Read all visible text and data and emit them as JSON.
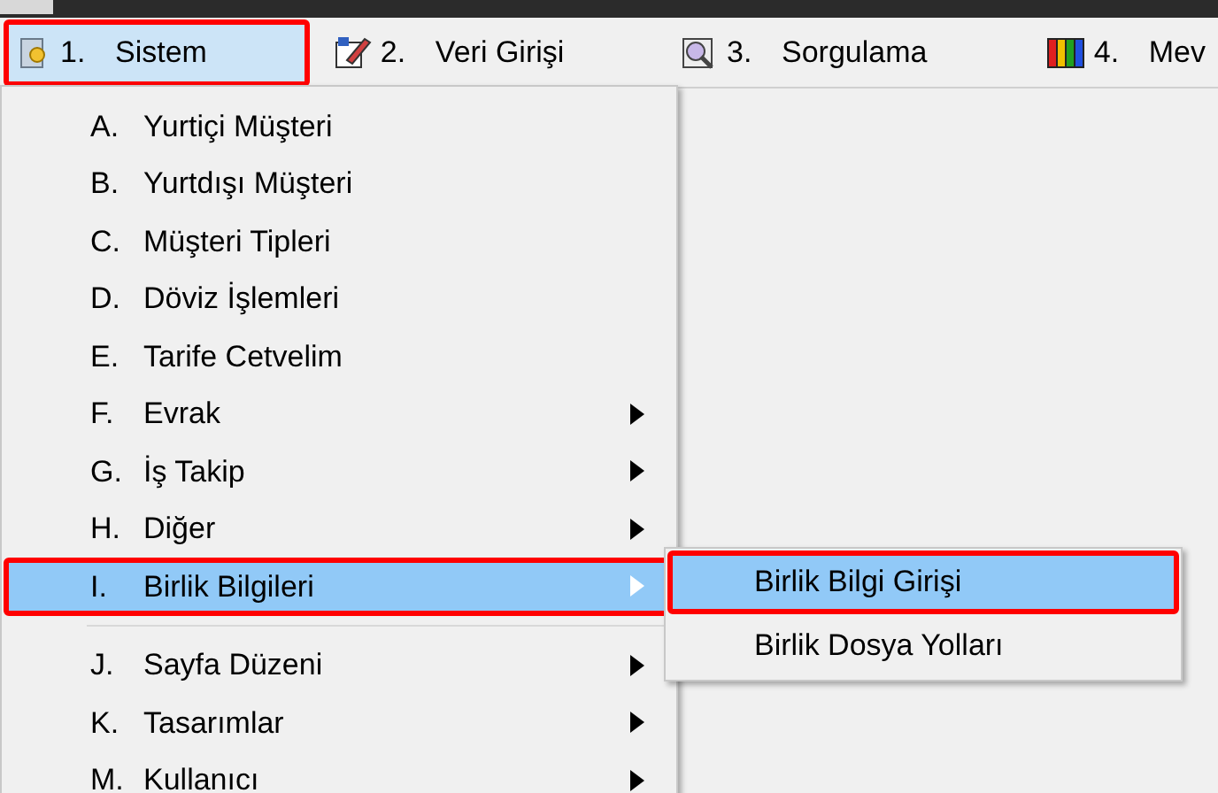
{
  "menu_bar": [
    {
      "number": "1.",
      "label": "Sistem",
      "selected": true,
      "annotated": true
    },
    {
      "number": "2.",
      "label": "Veri Girişi",
      "selected": false,
      "annotated": false
    },
    {
      "number": "3.",
      "label": "Sorgulama",
      "selected": false,
      "annotated": false
    },
    {
      "number": "4.",
      "label": "Mev",
      "selected": false,
      "annotated": false
    }
  ],
  "dropdown": {
    "items": [
      {
        "kind": "item",
        "key": "A.",
        "label": "Yurtiçi Müşteri",
        "submenu": false,
        "selected": false,
        "annotated": false
      },
      {
        "kind": "item",
        "key": "B.",
        "label": "Yurtdışı Müşteri",
        "submenu": false,
        "selected": false,
        "annotated": false
      },
      {
        "kind": "item",
        "key": "C.",
        "label": "Müşteri Tipleri",
        "submenu": false,
        "selected": false,
        "annotated": false
      },
      {
        "kind": "item",
        "key": "D.",
        "label": "Döviz İşlemleri",
        "submenu": false,
        "selected": false,
        "annotated": false
      },
      {
        "kind": "item",
        "key": "E.",
        "label": "Tarife Cetvelim",
        "submenu": false,
        "selected": false,
        "annotated": false
      },
      {
        "kind": "item",
        "key": "F.",
        "label": "Evrak",
        "submenu": true,
        "selected": false,
        "annotated": false
      },
      {
        "kind": "item",
        "key": "G.",
        "label": "İş Takip",
        "submenu": true,
        "selected": false,
        "annotated": false
      },
      {
        "kind": "item",
        "key": "H.",
        "label": "Diğer",
        "submenu": true,
        "selected": false,
        "annotated": false
      },
      {
        "kind": "item",
        "key": "I.",
        "label": "Birlik Bilgileri",
        "submenu": true,
        "selected": true,
        "annotated": true
      },
      {
        "kind": "separator"
      },
      {
        "kind": "item",
        "key": "J.",
        "label": "Sayfa Düzeni",
        "submenu": true,
        "selected": false,
        "annotated": false
      },
      {
        "kind": "item",
        "key": "K.",
        "label": "Tasarımlar",
        "submenu": true,
        "selected": false,
        "annotated": false
      },
      {
        "kind": "item",
        "key": "M.",
        "label": "Kullanıcı",
        "submenu": true,
        "selected": false,
        "annotated": false
      }
    ]
  },
  "submenu": {
    "items": [
      {
        "label": "Birlik Bilgi Girişi",
        "selected": true,
        "annotated": true
      },
      {
        "label": "Birlik Dosya Yolları",
        "selected": false,
        "annotated": false
      }
    ]
  }
}
